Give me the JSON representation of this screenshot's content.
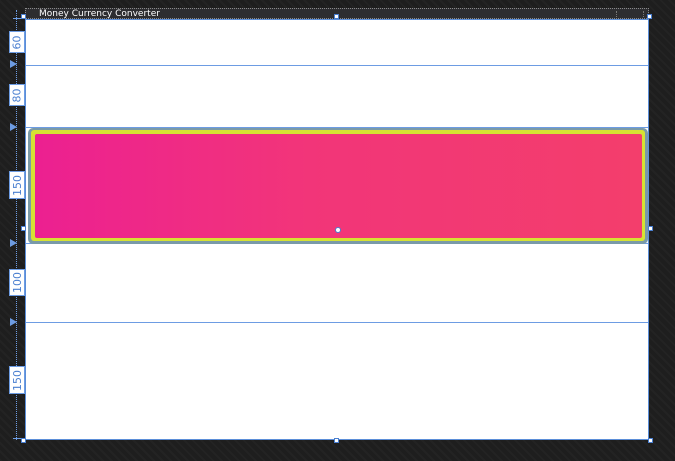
{
  "window": {
    "title": "Money Currency Converter"
  },
  "grid_rows": [
    {
      "height_label": "60"
    },
    {
      "height_label": "80"
    },
    {
      "height_label": "150"
    },
    {
      "height_label": "100"
    },
    {
      "height_label": "150"
    }
  ],
  "colors": {
    "gradient_start": "#ec2091",
    "gradient_end": "#f33e6c",
    "selection_accent": "#d6e233",
    "guide_lines": "#6d9ce3",
    "designer_background": "#1e1e1e"
  }
}
